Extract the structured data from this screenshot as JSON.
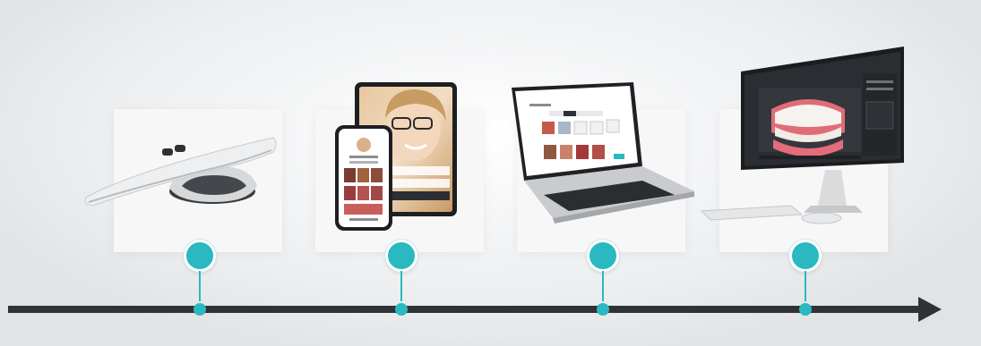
{
  "diagram": {
    "type": "timeline",
    "steps": [
      {
        "icon": "intraoral-scanner-icon"
      },
      {
        "icon": "tablet-phone-app-icon"
      },
      {
        "icon": "laptop-software-icon"
      },
      {
        "icon": "desktop-3d-model-icon"
      }
    ]
  },
  "colors": {
    "accent": "#2ab8c1",
    "axis": "#2f3336",
    "card": "#f7f7f8",
    "background": "#eceef0"
  }
}
